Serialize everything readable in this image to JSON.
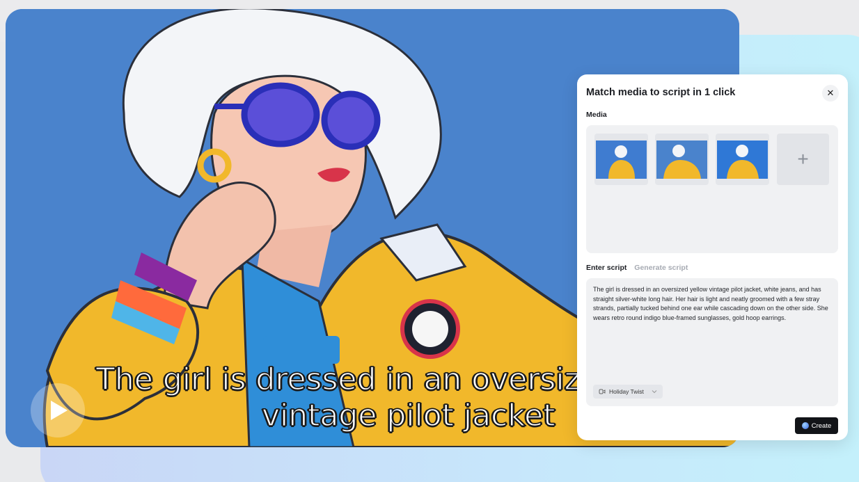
{
  "panel": {
    "title": "Match media to script in 1 click",
    "close_icon": "close-icon",
    "media_label": "Media",
    "media_thumbnails": [
      "thumbnail-1",
      "thumbnail-2",
      "thumbnail-3"
    ],
    "add_media_symbol": "+",
    "tabs": [
      {
        "label": "Enter script",
        "active": true
      },
      {
        "label": "Generate script",
        "active": false
      }
    ],
    "script_text": "The girl is dressed in an oversized yellow vintage pilot jacket, white jeans, and has straight silver-white long hair. Her hair is light and neatly groomed with a few stray strands, partially tucked behind one ear while cascading down on the other side. She wears retro round indigo blue-framed sunglasses, gold hoop earrings.",
    "style_chip": "Holiday Twist",
    "create_label": "Create"
  },
  "video": {
    "subtitle_line1": "The girl is dressed in an oversize",
    "subtitle_line2": "vintage pilot jacket",
    "play_icon": "play-icon"
  },
  "colors": {
    "video_bg": "#4a83cc",
    "jacket": "#f1b82b",
    "accent_button": "#121418",
    "panel_bg": "#ffffff",
    "field_bg": "#f0f1f3"
  }
}
